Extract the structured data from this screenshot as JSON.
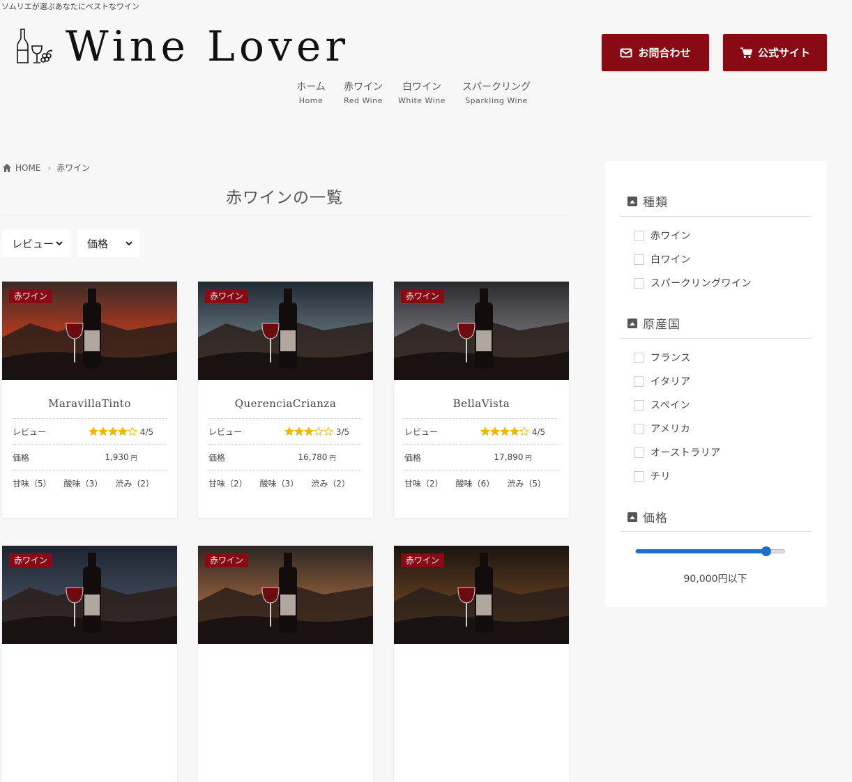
{
  "header": {
    "tagline": "ソムリエが選ぶあなたにベストなワイン",
    "logo_text": "Wine Lover",
    "contact_label": "お問合わせ",
    "official_label": "公式サイト"
  },
  "nav": [
    {
      "jp": "ホーム",
      "en": "Home"
    },
    {
      "jp": "赤ワイン",
      "en": "Red Wine"
    },
    {
      "jp": "白ワイン",
      "en": "White Wine"
    },
    {
      "jp": "スパークリング",
      "en": "Sparkling Wine"
    }
  ],
  "breadcrumb": {
    "home": "HOME",
    "current": "赤ワイン"
  },
  "page_title": "赤ワインの一覧",
  "filters": {
    "review": "レビュー",
    "price": "価格"
  },
  "cards": [
    {
      "badge": "赤ワイン",
      "name": "MaravillaTinto",
      "review_label": "レビュー",
      "rating": 4,
      "rating_text": "4/5",
      "price_label": "価格",
      "price": "1,930",
      "currency": "円",
      "sweet": "甘味（5）",
      "acid": "酸味（3）",
      "bitter": "渋み（2）"
    },
    {
      "badge": "赤ワイン",
      "name": "QuerenciaCrianza",
      "review_label": "レビュー",
      "rating": 3,
      "rating_text": "3/5",
      "price_label": "価格",
      "price": "16,780",
      "currency": "円",
      "sweet": "甘味（2）",
      "acid": "酸味（3）",
      "bitter": "渋み（2）"
    },
    {
      "badge": "赤ワイン",
      "name": "BellaVista",
      "review_label": "レビュー",
      "rating": 4,
      "rating_text": "4/5",
      "price_label": "価格",
      "price": "17,890",
      "currency": "円",
      "sweet": "甘味（2）",
      "acid": "酸味（6）",
      "bitter": "渋み（5）"
    },
    {
      "badge": "赤ワイン"
    },
    {
      "badge": "赤ワイン"
    },
    {
      "badge": "赤ワイン"
    }
  ],
  "sidebar": {
    "type_heading": "種類",
    "types": [
      "赤ワイン",
      "白ワイン",
      "スパークリングワイン"
    ],
    "origin_heading": "原産国",
    "origins": [
      "フランス",
      "イタリア",
      "スペイン",
      "アメリカ",
      "オーストラリア",
      "チリ"
    ],
    "price_heading": "価格",
    "price_value": 0.88,
    "price_text": "90,000円以下"
  },
  "colors": {
    "accent": "#870a14",
    "slider": "#1a73c8",
    "star": "#f2b705"
  }
}
